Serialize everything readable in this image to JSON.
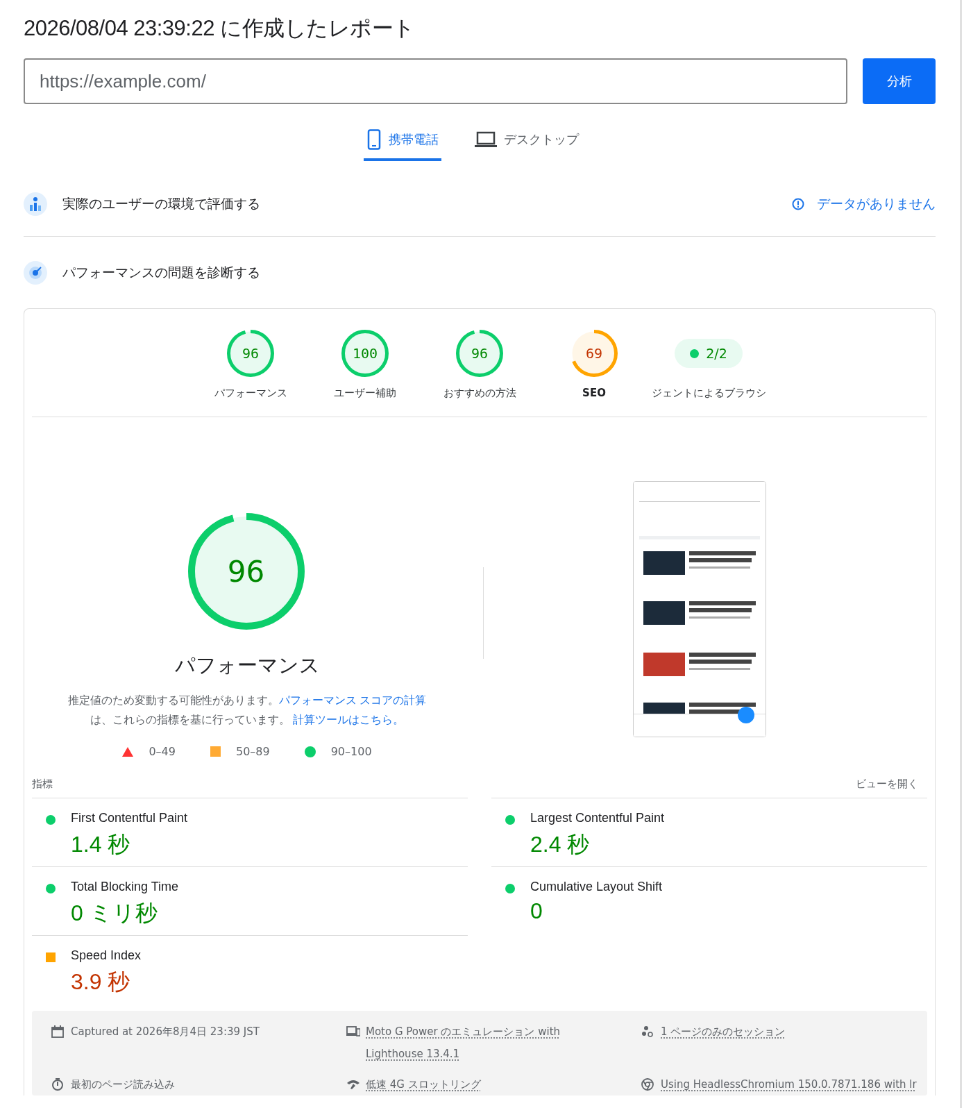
{
  "report_title": "2026/08/04 23:39:22 に作成したレポート",
  "url_field": {
    "value": "https://example.com/"
  },
  "analyze_button": "分析",
  "tabs": [
    {
      "label": "携帯電話",
      "kind": "phone",
      "selected": true
    },
    {
      "label": "デスクトップ",
      "kind": "laptop",
      "selected": false
    }
  ],
  "field_section": {
    "title": "実際のユーザーの環境で評価する",
    "status": "データがありません"
  },
  "lab_section": {
    "title": "パフォーマンスの問題を診断する"
  },
  "gauges": [
    {
      "kind": "gauge",
      "score": "96",
      "level": 0.96,
      "color": "#0cce6b",
      "label": "パフォーマンス",
      "bold": false
    },
    {
      "kind": "gauge",
      "score": "100",
      "level": 1,
      "color": "#0cce6b",
      "label": "ユーザー補助",
      "bold": false
    },
    {
      "kind": "gauge",
      "score": "96",
      "level": 0.96,
      "color": "#0cce6b",
      "label": "おすすめの方法",
      "bold": false
    },
    {
      "kind": "gauge",
      "score": "69",
      "level": 0.69,
      "color": "#ffa400",
      "label": "SEO",
      "bold": true
    },
    {
      "kind": "pill",
      "score": "2/2",
      "color": "#0cce6b",
      "label": "ジェントによるブラウシ",
      "bold": false
    }
  ],
  "performance": {
    "score": "96",
    "level": 0.96,
    "color": "#0cce6b",
    "title": "パフォーマンス",
    "description": "推定値のため変動する可能性があります。",
    "link_1": "パフォーマンス スコアの計算",
    "description_2": "は、これらの指標を基に行っています。",
    "link_2": "計算ツールはこちら。",
    "legend": [
      {
        "kind": "triangle",
        "label": "0–49"
      },
      {
        "kind": "square",
        "label": "50–89"
      },
      {
        "kind": "circle",
        "label": "90–100"
      }
    ]
  },
  "metrics_header": {
    "title": "指標",
    "toggle": "ビューを開く"
  },
  "metrics": [
    {
      "name": "First Contentful Paint",
      "value": "1.4 秒",
      "color": "#0cce6b"
    },
    {
      "name": "Largest Contentful Paint",
      "value": "2.4 秒",
      "color": "#0cce6b"
    },
    {
      "name": "Total Blocking Time",
      "value": "0 ミリ秒",
      "color": "#0cce6b"
    },
    {
      "name": "Cumulative Layout Shift",
      "value": "0",
      "color": "#0cce6b"
    },
    {
      "name": "Speed Index",
      "value": "3.9 秒",
      "color": "#ffa400"
    }
  ],
  "run_info": [
    {
      "kind": "calendar",
      "text": "Captured at 2026年8月4日 23:39 JST",
      "link": false
    },
    {
      "kind": "devices",
      "text": "Moto G Power のエミュレーション with Lighthouse 13.4.1",
      "link": true
    },
    {
      "kind": "people",
      "text": "1 ページのみのセッション",
      "link": true
    },
    {
      "kind": "timer",
      "text": "最初のページ読み込み",
      "link": false
    },
    {
      "kind": "signal",
      "text": "低速 4G スロットリング",
      "link": true
    },
    {
      "kind": "chrome",
      "text": "Using HeadlessChromium 150.0.7871.186 with lr",
      "link": true
    }
  ]
}
